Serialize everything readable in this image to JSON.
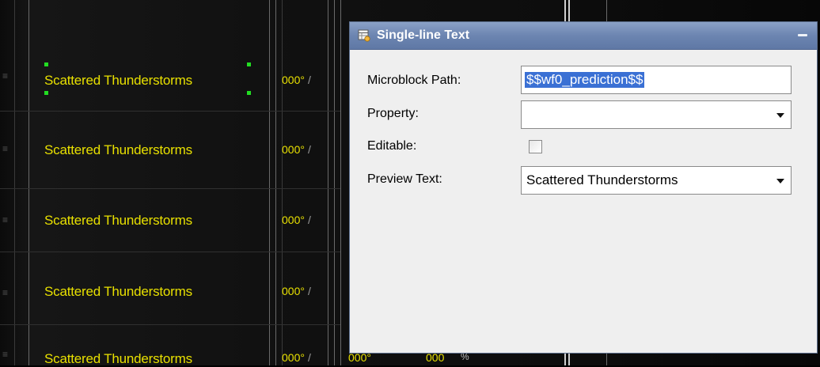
{
  "canvas": {
    "rows": [
      {
        "label": "Scattered Thunderstorms",
        "degree": "000°",
        "separator": "/",
        "selected": true
      },
      {
        "label": "Scattered Thunderstorms",
        "degree": "000°",
        "separator": "/",
        "selected": false
      },
      {
        "label": "Scattered Thunderstorms",
        "degree": "000°",
        "separator": "/",
        "selected": false
      },
      {
        "label": "Scattered Thunderstorms",
        "degree": "000°",
        "separator": "/",
        "selected": false
      },
      {
        "label": "Scattered Thunderstorms",
        "degree": "000°",
        "separator": "/",
        "selected": false
      }
    ],
    "bottom_degree_2": "000°",
    "bottom_value": "000",
    "bottom_percent": "%"
  },
  "panel": {
    "title": "Single-line Text",
    "fields": {
      "microblock_path": {
        "label": "Microblock Path:",
        "value": "$$wf0_prediction$$"
      },
      "property": {
        "label": "Property:",
        "value": ""
      },
      "editable": {
        "label": "Editable:",
        "checked": false
      },
      "preview_text": {
        "label": "Preview Text:",
        "value": "Scattered Thunderstorms"
      }
    }
  },
  "colors": {
    "text_yellow": "#e8e000",
    "titlebar": "#6c85b1",
    "selection": "#3a70d4"
  },
  "icons": [
    "table-icon",
    "minimize-icon",
    "chevron-down-icon"
  ]
}
